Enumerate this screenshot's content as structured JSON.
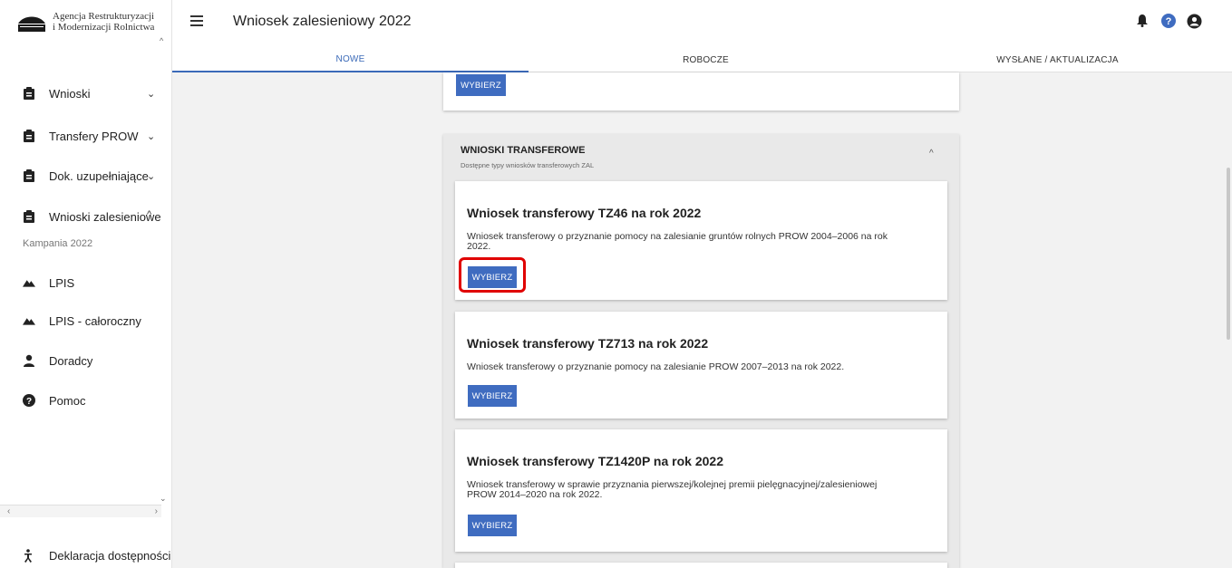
{
  "sidebar": {
    "logo_line1": "Agencja Restrukturyzacji",
    "logo_line2": "i Modernizacji Rolnictwa",
    "items": [
      {
        "label": "Wnioski",
        "icon": "clipboard-icon"
      },
      {
        "label": "Transfery PROW",
        "icon": "clipboard-icon"
      },
      {
        "label": "Dok. uzupełniające",
        "icon": "clipboard-icon"
      },
      {
        "label": "Wnioski zalesieniowe",
        "icon": "clipboard-icon"
      },
      {
        "label": "LPIS",
        "icon": "mountain-icon"
      },
      {
        "label": "LPIS - całoroczny",
        "icon": "mountain-icon"
      },
      {
        "label": "Doradcy",
        "icon": "person-icon"
      },
      {
        "label": "Pomoc",
        "icon": "help-icon"
      }
    ],
    "sub_item": "Kampania 2022",
    "footer_label": "Deklaracja dostępności"
  },
  "header": {
    "title": "Wniosek zalesieniowy 2022"
  },
  "tabs": [
    {
      "label": "NOWE",
      "active": true
    },
    {
      "label": "ROBOCZE",
      "active": false
    },
    {
      "label": "WYSŁANE / AKTUALIZACJA",
      "active": false
    }
  ],
  "prev_card": {
    "button": "WYBIERZ"
  },
  "panel": {
    "title": "WNIOSKI TRANSFEROWE",
    "subtitle": "Dostępne typy wniosków transferowych ZAL"
  },
  "cards": [
    {
      "title": "Wniosek transferowy TZ46 na rok 2022",
      "desc1": "Wniosek transferowy o przyznanie pomocy na zalesianie gruntów rolnych PROW 2004–2006 na rok",
      "desc2": "2022.",
      "button": "WYBIERZ"
    },
    {
      "title": "Wniosek transferowy TZ713 na rok 2022",
      "desc1": "Wniosek transferowy o przyznanie pomocy na zalesianie PROW 2007–2013 na rok 2022.",
      "button": "WYBIERZ"
    },
    {
      "title": "Wniosek transferowy TZ1420P na rok 2022",
      "desc1": "Wniosek transferowy w sprawie przyznania pierwszej/kolejnej premii pielęgnacyjnej/zalesieniowej",
      "desc2": "PROW 2014–2020 na rok 2022.",
      "button": "WYBIERZ"
    }
  ],
  "colors": {
    "accent": "#3f6cc0",
    "tab_active": "#3b6ab8",
    "highlight": "#e00000"
  }
}
